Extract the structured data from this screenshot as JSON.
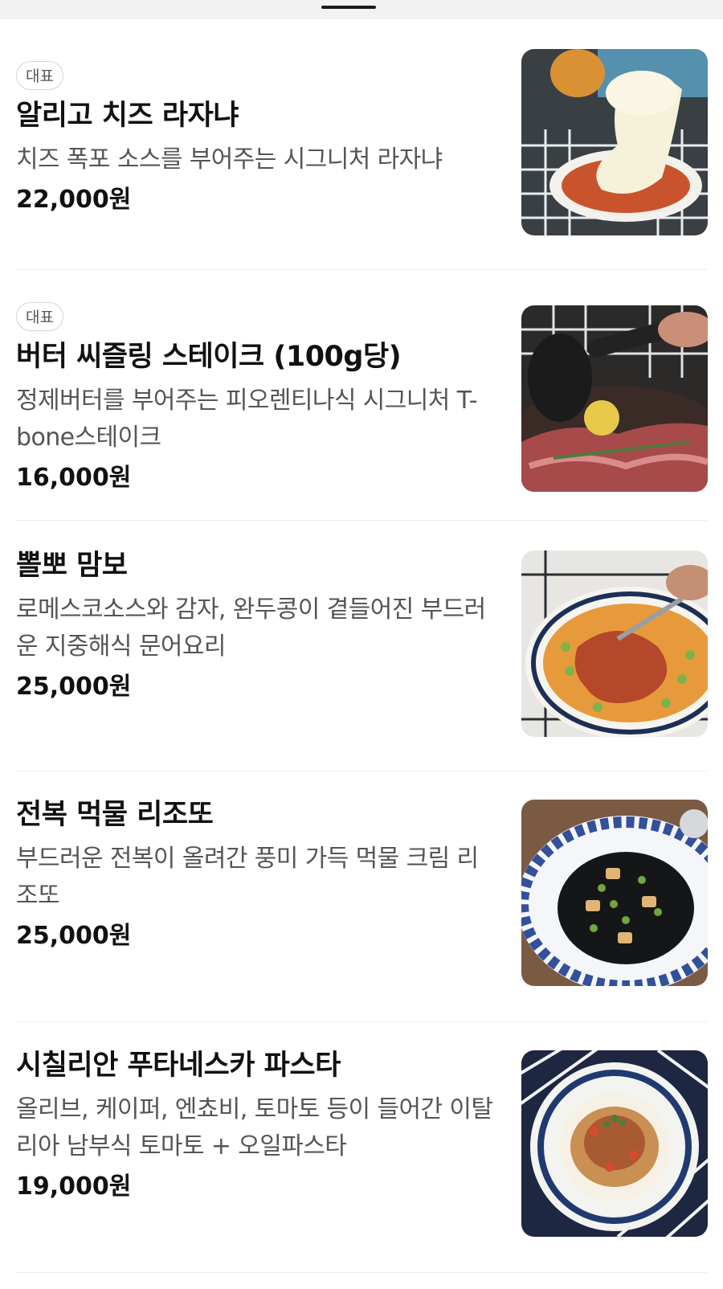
{
  "menu": {
    "items": [
      {
        "badge": "대표",
        "name": "알리고 치즈 라자냐",
        "description": "치즈 폭포 소스를 부어주는 시그니처 라자냐",
        "price": "22,000원"
      },
      {
        "badge": "대표",
        "name": "버터 씨즐링 스테이크 (100g당)",
        "description": "정제버터를 부어주는 피오렌티나식 시그니처 T-bone스테이크",
        "price": "16,000원"
      },
      {
        "name": "뽈뽀 맘보",
        "description": "로메스코소스와 감자, 완두콩이 곁들어진 부드러운 지중해식 문어요리",
        "price": "25,000원"
      },
      {
        "name": "전복 먹물 리조또",
        "description": "부드러운 전복이 올려간 풍미 가득 먹물 크림 리조또",
        "price": "25,000원"
      },
      {
        "name": "시칠리안 푸타네스카 파스타",
        "description": "올리브, 케이퍼, 엔쵸비, 토마토 등이 들어간 이탈리아 남부식 토마토 + 오일파스타",
        "price": "19,000원"
      }
    ]
  }
}
